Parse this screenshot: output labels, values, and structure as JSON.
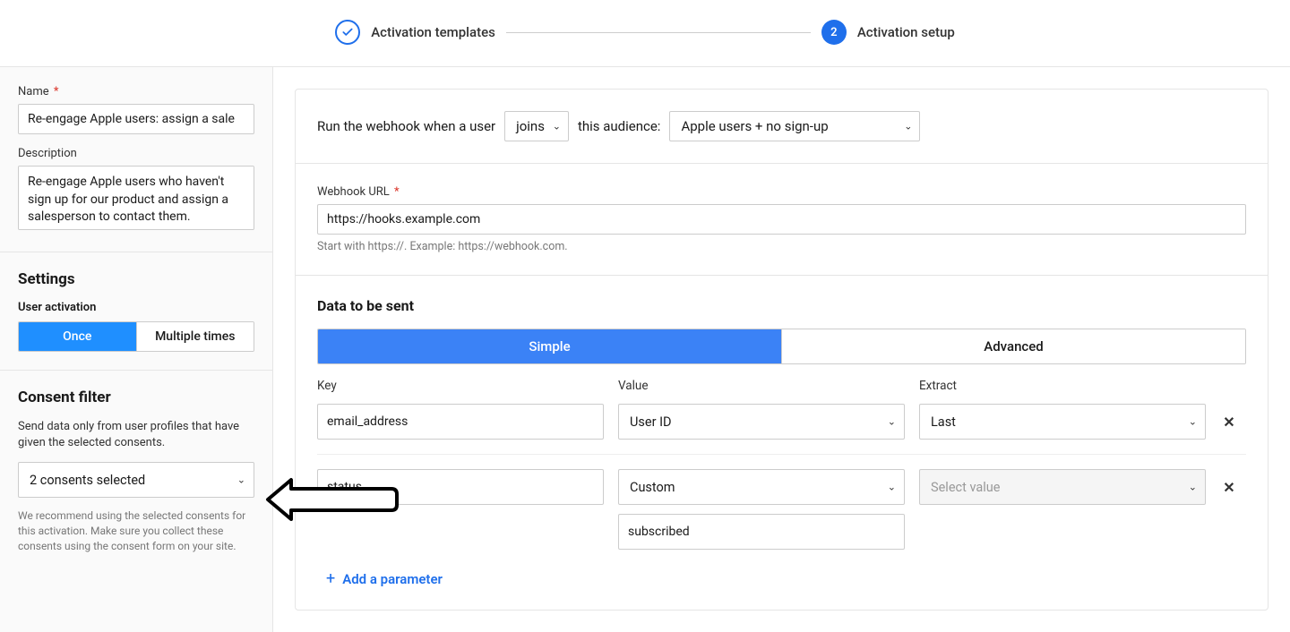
{
  "stepper": {
    "step1_label": "Activation templates",
    "step2_number": "2",
    "step2_label": "Activation setup"
  },
  "sidebar": {
    "name_label": "Name",
    "name_value": "Re-engage Apple users: assign a sale",
    "description_label": "Description",
    "description_value": "Re-engage Apple users who haven't sign up for our product and assign a salesperson to contact them.",
    "settings_heading": "Settings",
    "user_activation_label": "User activation",
    "once_label": "Once",
    "multiple_label": "Multiple times",
    "consent_heading": "Consent filter",
    "consent_desc": "Send data only from user profiles that have given the selected consents.",
    "consent_select_value": "2 consents selected",
    "consent_note": "We recommend using the selected consents for this activation. Make sure you collect these consents using the consent form on your site."
  },
  "main": {
    "trigger": {
      "prefix": "Run the webhook when a user",
      "action_value": "joins",
      "middle": "this audience:",
      "audience_value": "Apple users + no sign-up"
    },
    "webhook": {
      "label": "Webhook URL",
      "value": "https://hooks.example.com",
      "hint": "Start with https://. Example: https://webhook.com."
    },
    "data_section": {
      "title": "Data to be sent",
      "tab_simple": "Simple",
      "tab_advanced": "Advanced",
      "col_key": "Key",
      "col_value": "Value",
      "col_extract": "Extract",
      "rows": [
        {
          "key": "email_address",
          "value": "User ID",
          "extract": "Last",
          "custom": ""
        },
        {
          "key": "status",
          "value": "Custom",
          "extract_placeholder": "Select value",
          "custom": "subscribed"
        }
      ],
      "add_label": "Add a parameter"
    }
  }
}
